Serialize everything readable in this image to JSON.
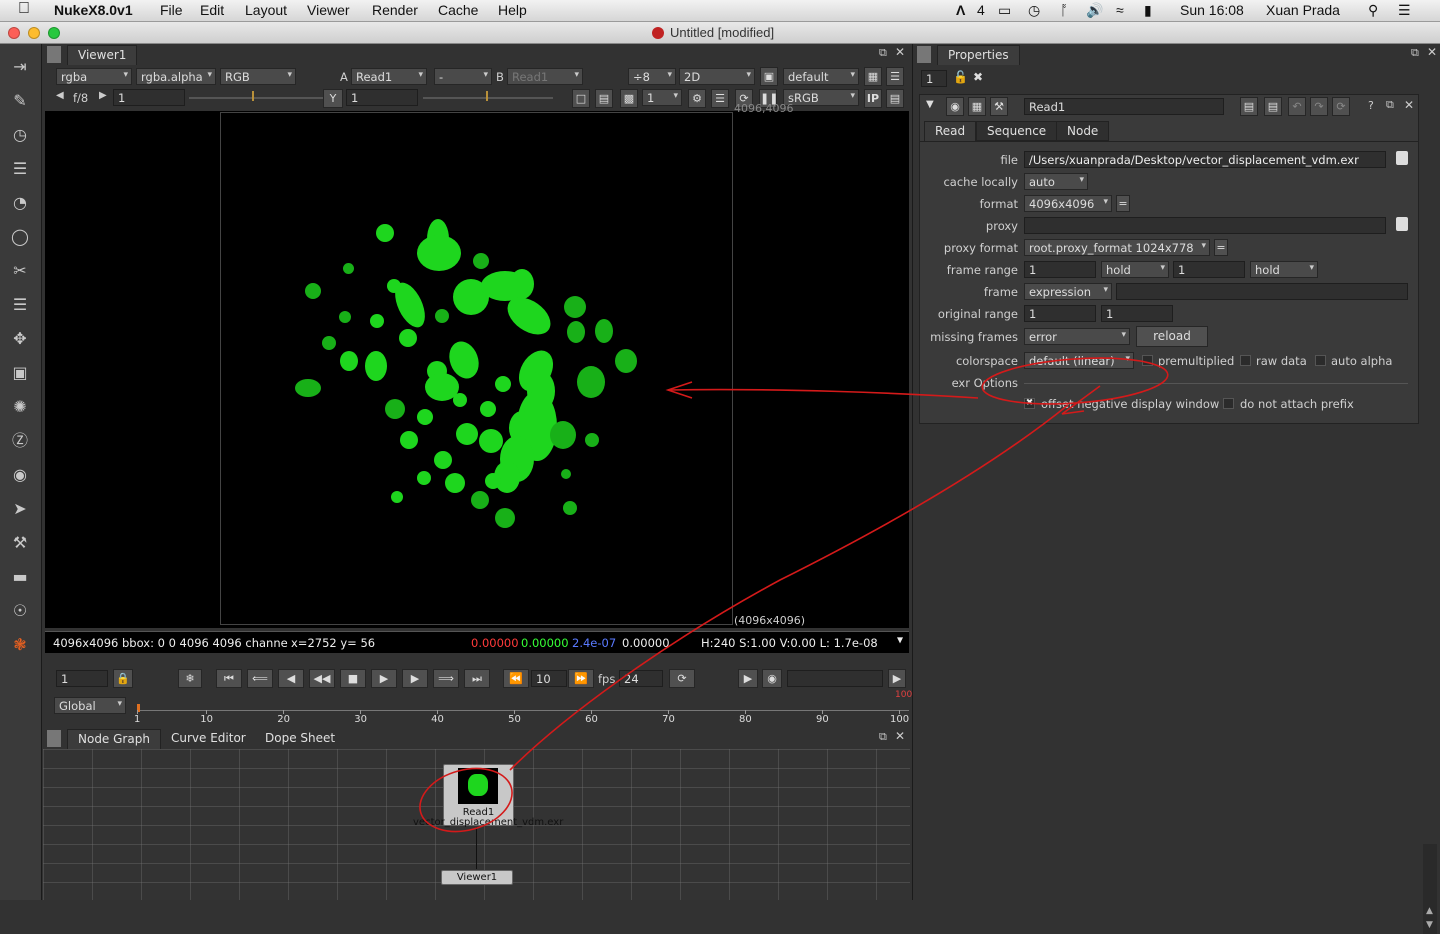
{
  "menubar": {
    "app": "NukeX8.0v1",
    "items": [
      "File",
      "Edit",
      "Layout",
      "Viewer",
      "Render",
      "Cache",
      "Help"
    ],
    "status_adobe": "4",
    "datetime": "Sun 16:08",
    "user": "Xuan Prada"
  },
  "window": {
    "title": "Untitled [modified]"
  },
  "viewer": {
    "tab": "Viewer1",
    "channels": "rgba",
    "alpha_channel": "rgba.alpha",
    "display_channels": "RGB",
    "a_label": "A",
    "a_input": "Read1",
    "wipe": "-",
    "b_label": "B",
    "b_input": "Read1",
    "downrez": "÷8",
    "view_mode": "2D",
    "lut_default": "default",
    "fstop_label": "f/8",
    "gain_value": "1",
    "y_label": "Y",
    "gamma_value": "1",
    "proxy_value": "1",
    "colorspace": "sRGB",
    "ip_label": "IP",
    "top_right_label": "4096,4096",
    "format_label": "(4096x4096)",
    "info": {
      "left": "4096x4096 bbox: 0 0 4096 4096 channe",
      "coords": "x=2752 y= 56",
      "r": "0.00000",
      "g": "0.00000",
      "b": "2.4e-07",
      "a": "0.00000",
      "hsv": "H:240 S:1.00 V:0.00  L: 1.7e-08"
    }
  },
  "timeline": {
    "frame": "1",
    "skip": "10",
    "fps_label": "fps",
    "fps": "24",
    "range_mode": "Global",
    "end_marker": "100",
    "ticks": [
      "1",
      "10",
      "20",
      "30",
      "40",
      "50",
      "60",
      "70",
      "80",
      "90",
      "100"
    ]
  },
  "nodegraph": {
    "tabs": [
      "Node Graph",
      "Curve Editor",
      "Dope Sheet"
    ],
    "read_node_name": "Read1",
    "read_node_file": "vector_displacement_vdm.exr",
    "viewer_node": "Viewer1"
  },
  "properties": {
    "tab": "Properties",
    "max_panels": "1",
    "node_name": "Read1",
    "tabs": [
      "Read",
      "Sequence",
      "Node"
    ],
    "file_label": "file",
    "file": "/Users/xuanprada/Desktop/vector_displacement_vdm.exr",
    "cache_label": "cache locally",
    "cache": "auto",
    "format_label": "format",
    "format": "4096x4096",
    "proxy_label": "proxy",
    "proxy_format_label": "proxy format",
    "proxy_format": "root.proxy_format 1024x778",
    "frame_range_label": "frame range",
    "range_start": "1",
    "before": "hold",
    "range_end": "1",
    "after": "hold",
    "frame_label": "frame",
    "frame_mode": "expression",
    "original_range_label": "original range",
    "orig_start": "1",
    "orig_end": "1",
    "missing_label": "missing frames",
    "missing": "error",
    "reload": "reload",
    "colorspace_label": "colorspace",
    "colorspace": "default (linear)",
    "premult_label": "premultiplied",
    "raw_label": "raw data",
    "auto_alpha_label": "auto alpha",
    "exr_label": "exr Options",
    "offset_label": "offset negative display window",
    "prefix_label": "do not attach prefix"
  },
  "colors": {
    "accent_red": "#d41a1a",
    "green_blob": "#1ed61e"
  }
}
